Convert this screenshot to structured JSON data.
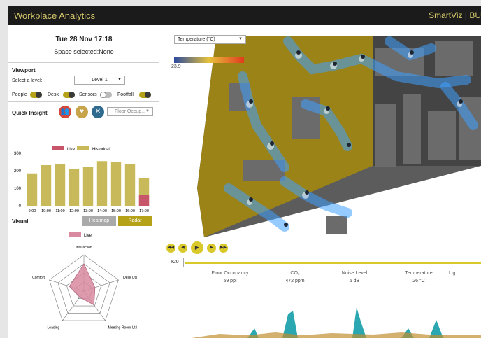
{
  "app": {
    "title": "Workplace Analytics",
    "brand": "SmartViz",
    "brand_cut": "BU"
  },
  "header": {
    "datetime": "Tue 28 Nov 17:18",
    "space_selected": "Space selected:None"
  },
  "viewport": {
    "title": "Viewport",
    "level_label": "Select a level:",
    "level_value": "Level 1",
    "toggles": [
      {
        "label": "People",
        "on": true
      },
      {
        "label": "Desk",
        "on": true
      },
      {
        "label": "Sensors",
        "on": false
      },
      {
        "label": "Footfall",
        "on": true
      }
    ]
  },
  "quick_insight": {
    "title": "Quick Insight",
    "dropdown_placeholder": "Floor Occup...",
    "icons": [
      "people-icon",
      "heart-icon",
      "tools-icon"
    ]
  },
  "visual": {
    "title": "Visual",
    "buttons": [
      "Heatmap",
      "Radar"
    ],
    "active": "Radar"
  },
  "map": {
    "dropdown": "Temperature (°C)",
    "scale_min_label": "23.9"
  },
  "playback": {
    "speed": "x20"
  },
  "stats": [
    {
      "label": "Floor Occupancy",
      "value": "59 ppl"
    },
    {
      "label": "CO₂",
      "value": "472 ppm"
    },
    {
      "label": "Noise Level",
      "value": "6 dB"
    },
    {
      "label": "Temperature",
      "value": "26 °C"
    },
    {
      "label": "Lig",
      "value": ""
    }
  ],
  "colors": {
    "accent": "#b5a219",
    "live": "#c7566b",
    "historical": "#c8ba5a",
    "heat": "#3fa0ff"
  },
  "chart_data": [
    {
      "type": "bar",
      "categories": [
        "9:00",
        "10:00",
        "11:00",
        "12:00",
        "13:00",
        "14:00",
        "15:00",
        "16:00",
        "17:00"
      ],
      "series": [
        {
          "name": "Live",
          "values": [
            0,
            0,
            0,
            0,
            0,
            0,
            0,
            0,
            60
          ]
        },
        {
          "name": "Historical",
          "values": [
            185,
            232,
            240,
            210,
            222,
            255,
            250,
            240,
            160
          ]
        }
      ],
      "ylim": [
        0,
        300
      ],
      "yticks": [
        "0",
        "100",
        "200",
        "300"
      ]
    },
    {
      "type": "radar",
      "series": [
        {
          "name": "Live"
        }
      ],
      "axes": [
        "Interaction",
        "Desk Util",
        "Meeting Room Util",
        "Loading",
        "Comfort"
      ],
      "values": [
        0.75,
        0.32,
        0.47,
        0.2,
        0.42
      ],
      "rings": 4
    }
  ]
}
